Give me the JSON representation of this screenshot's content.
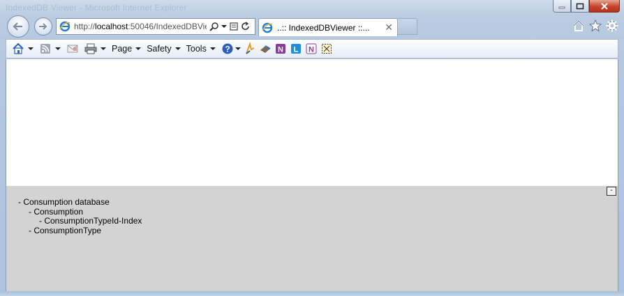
{
  "window": {
    "title": "IndexedDB Viewer - Microsoft Internet Explorer",
    "minimize_icon": "minimize-icon",
    "maximize_icon": "maximize-icon",
    "close_icon": "close-icon"
  },
  "nav": {
    "back_icon": "back-arrow-icon",
    "forward_icon": "forward-arrow-icon",
    "address_prefix": "http://",
    "address_host": "localhost",
    "address_rest": ":50046/IndexedDBVie",
    "tab_title": "..:: IndexedDBViewer ::..."
  },
  "command_bar": {
    "page_label": "Page",
    "safety_label": "Safety",
    "tools_label": "Tools"
  },
  "panel": {
    "collapse_label": "-",
    "tree": [
      {
        "text": "- Consumption database",
        "level": 1
      },
      {
        "text": "- Consumption",
        "level": 2
      },
      {
        "text": "- ConsumptionTypeId-Index",
        "level": 3
      },
      {
        "text": "- ConsumptionType",
        "level": 2
      }
    ]
  },
  "colors": {
    "panel_bg": "#d3d3d3",
    "close_button": "#c8432c"
  }
}
